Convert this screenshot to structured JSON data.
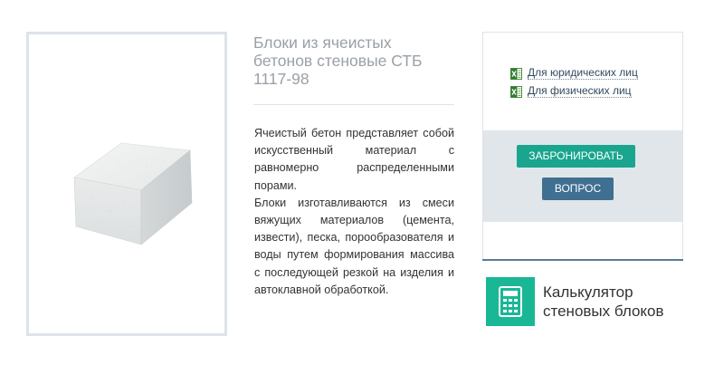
{
  "product": {
    "image_icon": "aerated-concrete-block",
    "title": "Блоки из ячеистых бетонов стеновые СТБ 1117-98",
    "description_p1": "Ячеистый бетон представляет собой искусственный материал с равномерно распределенными порами.",
    "description_p2": "Блоки изготавливаются из смеси вяжущих материалов (цемента, извести), песка, порообразователя и воды путем формирования массива с последующей резкой на изделия и автоклавной обработкой."
  },
  "sidebar": {
    "links": [
      {
        "label": "Для юридических лиц",
        "icon": "excel-icon"
      },
      {
        "label": "Для физических лиц",
        "icon": "excel-icon"
      }
    ],
    "book_button": "ЗАБРОНИРОВАТЬ",
    "ask_button": "ВОПРОС"
  },
  "calculator": {
    "icon": "calculator-icon",
    "label": "Калькулятор стеновых блоков"
  },
  "colors": {
    "accent_green": "#19a58e",
    "button_blue": "#3f6f91",
    "calc_green": "#19b796"
  }
}
